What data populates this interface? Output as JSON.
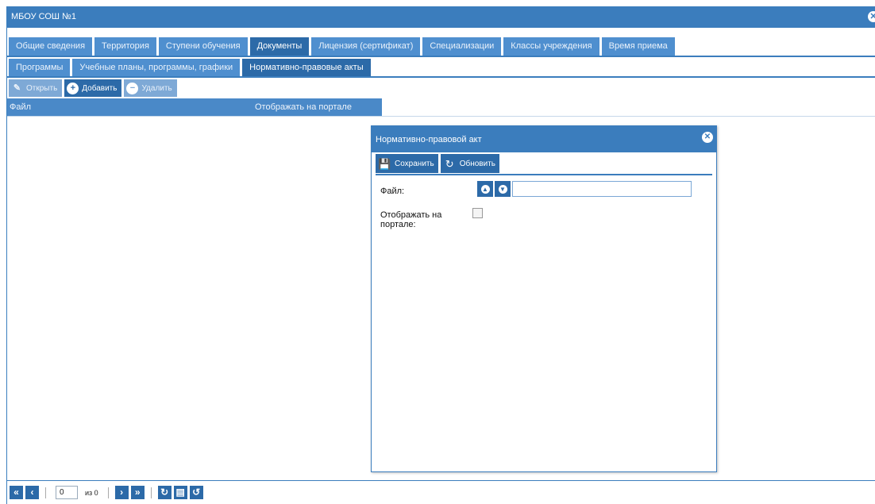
{
  "window": {
    "title": "МБОУ СОШ №1",
    "close_icon": "close-icon"
  },
  "tabs": [
    {
      "label": "Общие сведения"
    },
    {
      "label": "Территория"
    },
    {
      "label": "Ступени обучения"
    },
    {
      "label": "Документы",
      "active": true
    },
    {
      "label": "Лицензия (сертификат)"
    },
    {
      "label": "Специализации"
    },
    {
      "label": "Классы учреждения"
    },
    {
      "label": "Время приема"
    }
  ],
  "subtabs": [
    {
      "label": "Программы"
    },
    {
      "label": "Учебные планы, программы, графики"
    },
    {
      "label": "Нормативно-правовые акты",
      "active": true
    }
  ],
  "toolbar": {
    "open_label": "Открыть",
    "add_label": "Добавить",
    "delete_label": "Удалить"
  },
  "grid": {
    "columns": [
      "Файл",
      "Отображать на портале"
    ]
  },
  "pager": {
    "page_value": "0",
    "of_label": "из 0"
  },
  "dialog": {
    "title": "Нормативно-правовой акт",
    "save_label": "Сохранить",
    "refresh_label": "Обновить",
    "file_label": "Файл:",
    "file_value": "",
    "show_label": "Отображать на портале:",
    "show_checked": false
  },
  "colors": {
    "header": "#3b7dbd",
    "active_tab": "#2c6aa8",
    "tab": "#4f8fcf"
  }
}
